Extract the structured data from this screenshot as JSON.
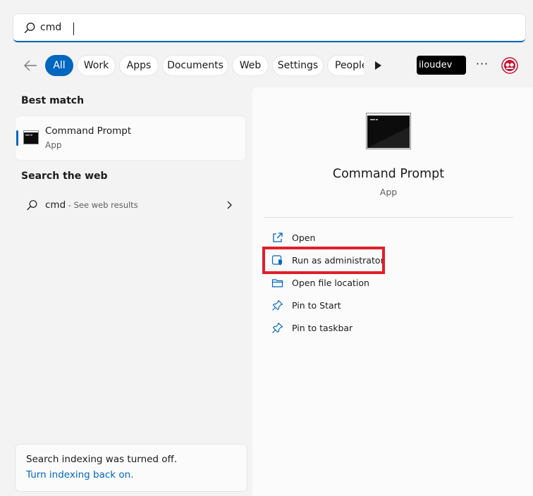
{
  "search": {
    "query": "cmd"
  },
  "filters": [
    "All",
    "Work",
    "Apps",
    "Documents",
    "Web",
    "Settings",
    "People"
  ],
  "account": {
    "name": "iloudev"
  },
  "left": {
    "best_match_title": "Best match",
    "best_match": {
      "name": "Command Prompt",
      "type": "App"
    },
    "search_web_title": "Search the web",
    "web_result": {
      "query": "cmd",
      "suffix": " - See web results"
    },
    "indexing": {
      "message": "Search indexing was turned off.",
      "link": "Turn indexing back on."
    }
  },
  "detail": {
    "name": "Command Prompt",
    "type": "App",
    "actions": [
      {
        "label": "Open",
        "icon": "open-external-icon"
      },
      {
        "label": "Run as administrator",
        "icon": "shield-icon"
      },
      {
        "label": "Open file location",
        "icon": "folder-icon"
      },
      {
        "label": "Pin to Start",
        "icon": "pin-icon"
      },
      {
        "label": "Pin to taskbar",
        "icon": "pin-icon"
      }
    ]
  },
  "colors": {
    "accent": "#0067c0",
    "highlight": "#e01f2b"
  }
}
